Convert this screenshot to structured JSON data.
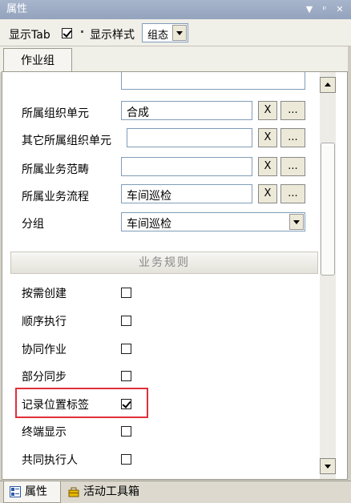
{
  "window": {
    "title": "属性"
  },
  "toolbar": {
    "show_tab_label": "显示Tab",
    "show_tab_checked": true,
    "show_style_label": "显示样式",
    "style_value": "组态"
  },
  "tabs": [
    {
      "label": "作业组"
    }
  ],
  "properties": [
    {
      "label": "",
      "value": "",
      "has_buttons": false
    },
    {
      "label": "所属组织单元",
      "value": "合成",
      "has_buttons": true
    },
    {
      "label": "其它所属组织单元",
      "value": "",
      "has_buttons": true
    },
    {
      "label": "所属业务范畴",
      "value": "",
      "has_buttons": true
    },
    {
      "label": "所属业务流程",
      "value": "车间巡检",
      "has_buttons": true
    }
  ],
  "group": {
    "label": "分组",
    "value": "车间巡检"
  },
  "buttons": {
    "clear": "X",
    "browse": "..."
  },
  "section": {
    "title": "业务规则"
  },
  "rules": [
    {
      "label": "按需创建",
      "checked": false
    },
    {
      "label": "顺序执行",
      "checked": false
    },
    {
      "label": "协同作业",
      "checked": false
    },
    {
      "label": "部分同步",
      "checked": false
    },
    {
      "label": "记录位置标签",
      "checked": true
    },
    {
      "label": "终端显示",
      "checked": false
    },
    {
      "label": "共同执行人",
      "checked": false
    }
  ],
  "bottom_tabs": [
    {
      "label": "属性",
      "icon": "properties-icon",
      "active": true
    },
    {
      "label": "活动工具箱",
      "icon": "toolbox-icon",
      "active": false
    }
  ],
  "colors": {
    "highlight": "#e0303a",
    "titlebar": "#9aa9c2"
  }
}
